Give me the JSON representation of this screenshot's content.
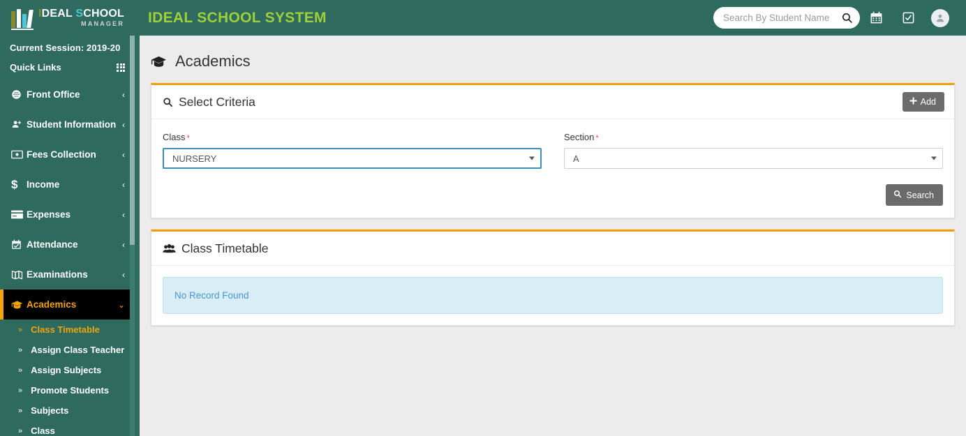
{
  "header": {
    "logo": {
      "part1": "I",
      "part2": "DEAL ",
      "part3": "S",
      "part4": "CHOOL",
      "sub": "MANAGER"
    },
    "app_title": "IDEAL SCHOOL SYSTEM",
    "search": {
      "placeholder": "Search By Student Name",
      "value": ""
    },
    "icons": {
      "search": "search-icon",
      "calendar": "calendar-icon",
      "checkbox": "check-square-icon",
      "avatar": "user-avatar"
    },
    "colors": {
      "bar": "#2e6b5e",
      "title": "#9fcf3a"
    }
  },
  "sidebar": {
    "session": "Current Session: 2019-20",
    "quick_links": "Quick Links",
    "quick_links_icon": "grid-icon",
    "items": [
      {
        "label": "Front Office",
        "icon": "support-headset-icon",
        "arrow": "‹"
      },
      {
        "label": "Student Information",
        "icon": "user-plus-icon",
        "arrow": "‹"
      },
      {
        "label": "Fees Collection",
        "icon": "money-bill-icon",
        "arrow": "‹"
      },
      {
        "label": "Income",
        "icon": "dollar-sign-icon",
        "arrow": "‹"
      },
      {
        "label": "Expenses",
        "icon": "credit-card-icon",
        "arrow": "‹"
      },
      {
        "label": "Attendance",
        "icon": "calendar-check-icon",
        "arrow": "‹"
      },
      {
        "label": "Examinations",
        "icon": "book-open-icon",
        "arrow": "‹"
      },
      {
        "label": "Academics",
        "icon": "graduation-cap-icon",
        "arrow": "⌄",
        "active": true
      }
    ],
    "submenu": [
      {
        "label": "Class Timetable",
        "active": true
      },
      {
        "label": "Assign Class Teacher",
        "active": false
      },
      {
        "label": "Assign Subjects",
        "active": false
      },
      {
        "label": "Promote Students",
        "active": false
      },
      {
        "label": "Subjects",
        "active": false
      },
      {
        "label": "Class",
        "active": false
      }
    ],
    "sub_chevron": "»",
    "colors": {
      "bg": "#2e6b5e",
      "active_bg": "#000000",
      "active_text": "#f0a30a"
    }
  },
  "page": {
    "title": "Academics",
    "title_icon": "graduation-cap-icon"
  },
  "criteria_panel": {
    "title": "Select Criteria",
    "title_icon": "search-icon",
    "add_label": "Add",
    "add_icon": "plus-icon",
    "search_label": "Search",
    "search_icon": "search-icon",
    "fields": {
      "class": {
        "label": "Class",
        "required": "*",
        "value": "NURSERY",
        "focused": true
      },
      "section": {
        "label": "Section",
        "required": "*",
        "value": "A",
        "focused": false
      }
    }
  },
  "timetable_panel": {
    "title": "Class Timetable",
    "title_icon": "users-icon",
    "empty_message": "No Record Found"
  },
  "colors": {
    "panel_accent": "#f39c12",
    "focus_border": "#3c8dbc",
    "info_bg": "#d9edf7",
    "info_text": "#4a96d2",
    "button_gray": "#6b6b6b",
    "page_bg": "#ececec"
  }
}
